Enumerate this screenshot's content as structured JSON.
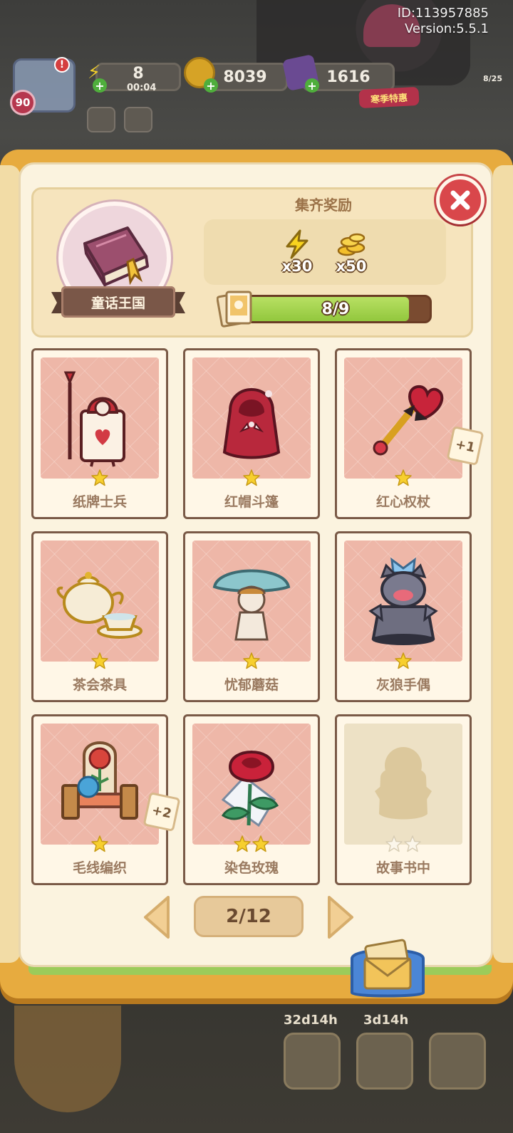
{
  "meta": {
    "player_id": "ID:113957885",
    "version": "Version:5.5.1"
  },
  "hud": {
    "level": "90",
    "energy_count": "8",
    "energy_timer": "00:04",
    "coins": "8039",
    "gems": "1616",
    "sale_label": "寒季特惠",
    "quest_progress": "8/25",
    "alert_mark": "!"
  },
  "album": {
    "name": "童话王国",
    "reward_title": "集齐奖励",
    "rewards": [
      {
        "icon": "energy-bolt-icon",
        "amount": "x30"
      },
      {
        "icon": "coin-stack-icon",
        "amount": "x50"
      }
    ],
    "progress_text": "8/9",
    "progress_value": 0.889
  },
  "cards": [
    {
      "name": "纸牌士兵",
      "stars": 1,
      "owned": true,
      "extra": ""
    },
    {
      "name": "红帽斗篷",
      "stars": 1,
      "owned": true,
      "extra": ""
    },
    {
      "name": "红心权杖",
      "stars": 1,
      "owned": true,
      "extra": "+1"
    },
    {
      "name": "茶会茶具",
      "stars": 1,
      "owned": true,
      "extra": ""
    },
    {
      "name": "忧郁蘑菇",
      "stars": 1,
      "owned": true,
      "extra": ""
    },
    {
      "name": "灰狼手偶",
      "stars": 1,
      "owned": true,
      "extra": ""
    },
    {
      "name": "毛线编织",
      "stars": 1,
      "owned": true,
      "extra": "+2"
    },
    {
      "name": "染色玫瑰",
      "stars": 2,
      "owned": true,
      "extra": ""
    },
    {
      "name": "故事书中",
      "stars": 2,
      "owned": false,
      "extra": ""
    }
  ],
  "pager": {
    "label": "2/12"
  },
  "bottom_bar": {
    "timer_1": "32d14h",
    "timer_2": "3d14h"
  },
  "colors": {
    "frame": "#e7ab3f",
    "paper": "#fbf3df",
    "close": "#d9474b",
    "progress_fill": "#a6d44f",
    "card_art": "#eeb7a8",
    "star": "#f7cf2e"
  }
}
